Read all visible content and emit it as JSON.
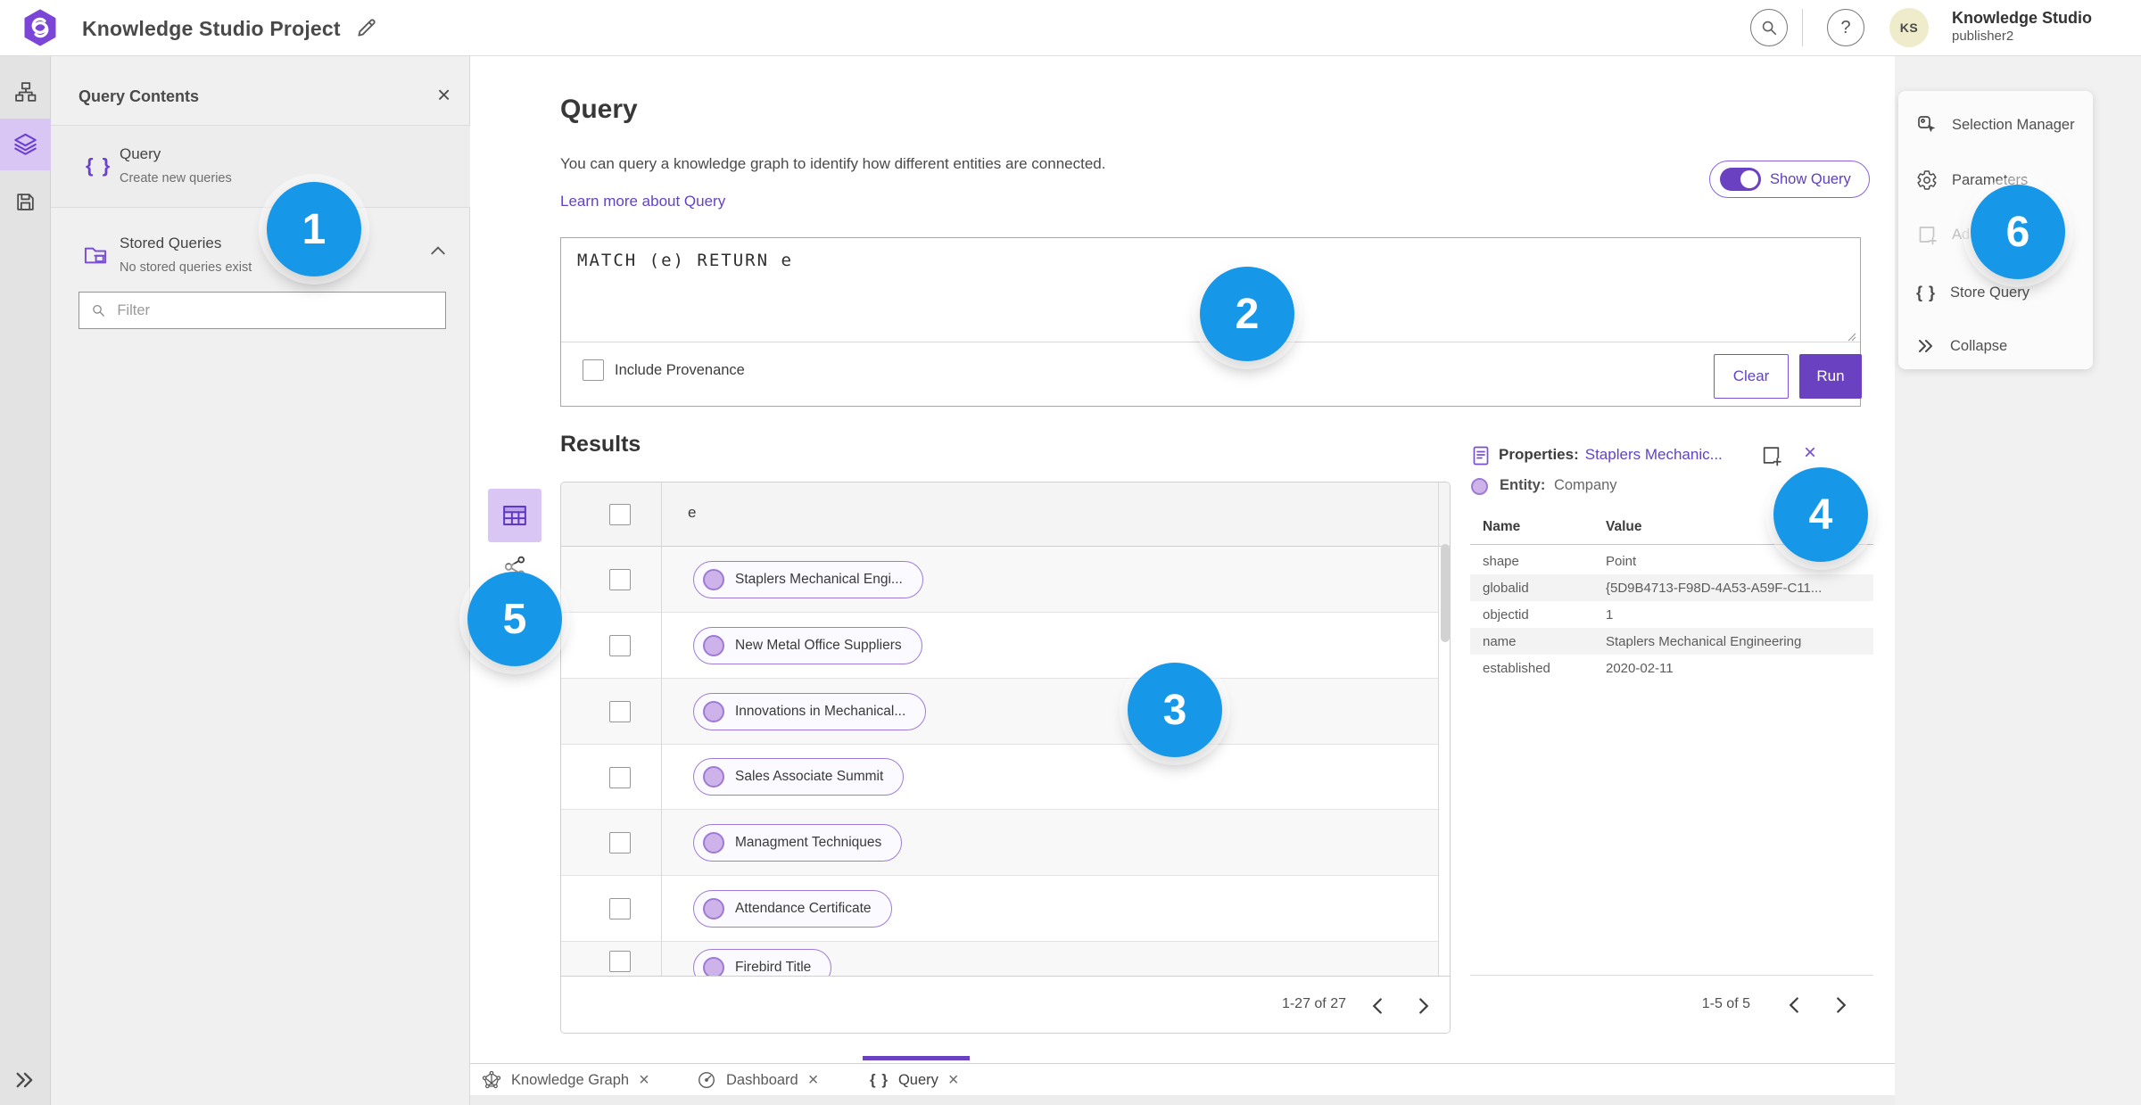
{
  "glyphs": {
    "close": "×",
    "braces": "{ }",
    "help": "?"
  },
  "colors": {
    "accent_purple": "#6a42c1",
    "link_purple": "#6243c6",
    "annotation_blue": "#1797e8",
    "selected_purple_bg": "#d9c6f5",
    "avatar_bg": "#eeeccb"
  },
  "top_bar": {
    "title": "Knowledge Studio Project",
    "user_initials": "KS",
    "user_name": "Knowledge Studio",
    "user_role": "publisher2"
  },
  "left_panel": {
    "title": "Query Contents",
    "query_item": {
      "title": "Query",
      "subtitle": "Create new queries"
    },
    "stored_queries": {
      "title": "Stored Queries",
      "subtitle": "No stored queries exist"
    },
    "filter_placeholder": "Filter"
  },
  "query_panel": {
    "heading": "Query",
    "description": "You can query a knowledge graph to identify how different entities are connected.",
    "learn_more_link": "Learn more about Query",
    "show_query_label": "Show Query",
    "query_text": "MATCH (e) RETURN e",
    "include_provenance_label": "Include Provenance",
    "clear_button": "Clear",
    "run_button": "Run"
  },
  "results_panel": {
    "heading": "Results",
    "column_header": "e",
    "rows": [
      {
        "label": "Staplers Mechanical Engi..."
      },
      {
        "label": "New Metal Office Suppliers"
      },
      {
        "label": "Innovations in Mechanical..."
      },
      {
        "label": "Sales Associate Summit"
      },
      {
        "label": "Managment Techniques"
      },
      {
        "label": "Attendance Certificate"
      },
      {
        "label": "Firebird Title"
      }
    ],
    "pagination": "1-27 of 27"
  },
  "properties_panel": {
    "title": "Properties:",
    "selected_entity": "Staplers Mechanic...",
    "entity_label": "Entity:",
    "entity_type": "Company",
    "columns": {
      "name": "Name",
      "value": "Value"
    },
    "rows": [
      {
        "name": "shape",
        "value": "Point"
      },
      {
        "name": "globalid",
        "value": "{5D9B4713-F98D-4A53-A59F-C11..."
      },
      {
        "name": "objectid",
        "value": "1"
      },
      {
        "name": "name",
        "value": "Staplers Mechanical Engineering"
      },
      {
        "name": "established",
        "value": "2020-02-11"
      }
    ],
    "pagination": "1-5 of 5"
  },
  "side_menu": {
    "items": [
      {
        "label": "Selection Manager"
      },
      {
        "label": "Parameters"
      },
      {
        "label": "Ad"
      },
      {
        "label": "Store Query"
      },
      {
        "label": "Collapse"
      }
    ]
  },
  "bottom_tabs": [
    {
      "label": "Knowledge Graph"
    },
    {
      "label": "Dashboard"
    },
    {
      "label": "Query"
    }
  ],
  "annotations": [
    {
      "n": "1"
    },
    {
      "n": "2"
    },
    {
      "n": "3"
    },
    {
      "n": "4"
    },
    {
      "n": "5"
    },
    {
      "n": "6"
    }
  ]
}
